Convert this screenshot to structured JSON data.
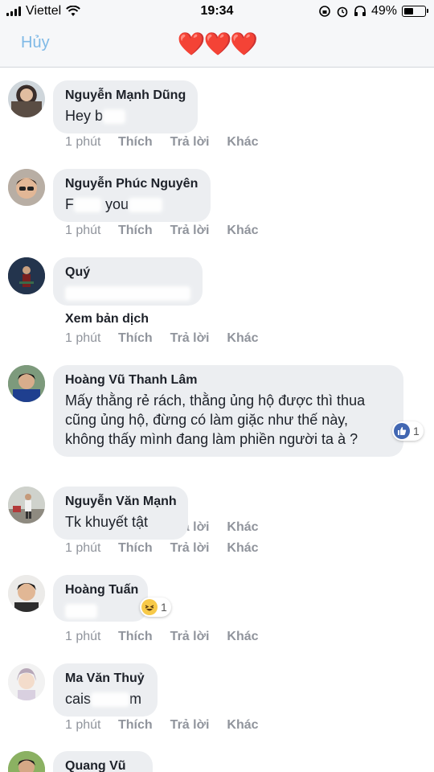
{
  "status": {
    "carrier": "Viettel",
    "time": "19:34",
    "battery": "49%",
    "battery_level": 0.49
  },
  "nav": {
    "cancel_label": "Hủy",
    "title": "❤️❤️❤️"
  },
  "actions": {
    "time": "1 phút",
    "like": "Thích",
    "reply": "Trả lời",
    "more": "Khác"
  },
  "comments": [
    {
      "author": "Nguyễn Mạnh Dũng",
      "text_before": "Hey b",
      "text_after": ""
    },
    {
      "author": "Nguyễn Phúc Nguyên",
      "text_before": "F",
      "text_mid": "you",
      "text_after": ""
    },
    {
      "author": "Quý",
      "translate": "Xem bản dịch"
    },
    {
      "author": "Hoàng Vũ Thanh Lâm",
      "lines": [
        "Mấy thằng rẻ rách, thằng ủng hộ được thì thua",
        "cũng ủng hộ, đừng có làm giặc như thế này,",
        "không thấy mình đang làm phiền người ta à ?"
      ],
      "reaction_count": "1"
    },
    {
      "author": "Nguyễn Văn Mạnh",
      "text": "Tk khuyết tật"
    },
    {
      "author": "Hoàng Tuấn",
      "reaction_count": "1"
    },
    {
      "author": "Ma Văn Thuỷ",
      "text_before": "cais",
      "text_after": "m"
    },
    {
      "author": "Quang Vũ"
    }
  ]
}
